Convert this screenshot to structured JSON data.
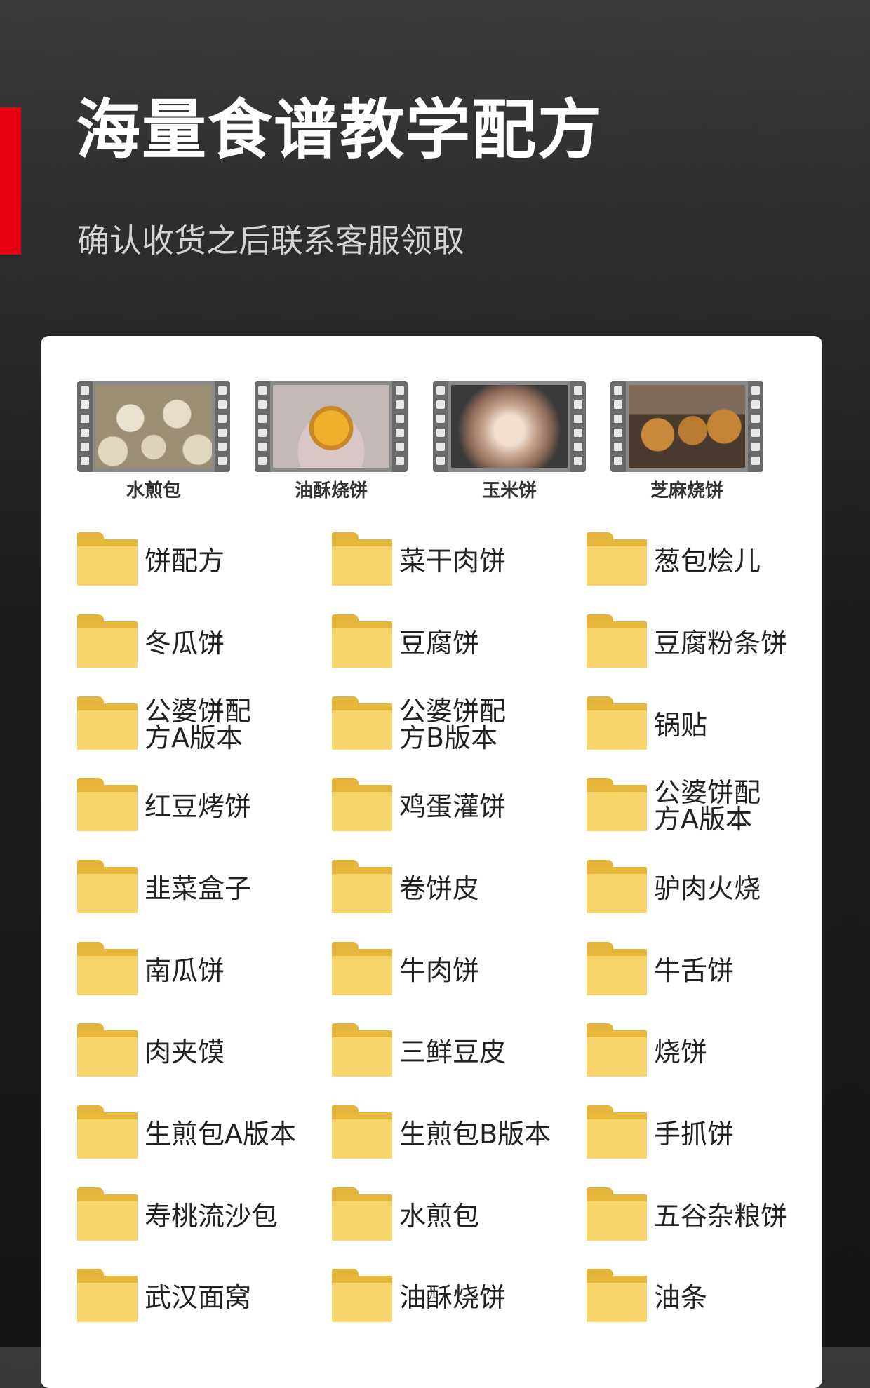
{
  "header": {
    "title": "海量食谱教学配方",
    "subtitle": "确认收货之后联系客服领取",
    "accent_color": "#e60012"
  },
  "videos": [
    {
      "label": "水煎包",
      "icon": "video-thumbnail-icon"
    },
    {
      "label": "油酥烧饼",
      "icon": "video-thumbnail-icon"
    },
    {
      "label": "玉米饼",
      "icon": "video-thumbnail-icon"
    },
    {
      "label": "芝麻烧饼",
      "icon": "video-thumbnail-icon"
    }
  ],
  "folder_icon": "folder-icon",
  "folder_color": "#f7d56b",
  "folders": [
    "饼配方",
    "菜干肉饼",
    "葱包烩儿",
    "冬瓜饼",
    "豆腐饼",
    "豆腐粉条饼",
    "公婆饼配方A版本",
    "公婆饼配方B版本",
    "锅贴",
    "红豆烤饼",
    "鸡蛋灌饼",
    "公婆饼配方A版本",
    "韭菜盒子",
    "卷饼皮",
    "驴肉火烧",
    "南瓜饼",
    "牛肉饼",
    "牛舌饼",
    "肉夹馍",
    "三鲜豆皮",
    "烧饼",
    "生煎包A版本",
    "生煎包B版本",
    "手抓饼",
    "寿桃流沙包",
    "水煎包",
    "五谷杂粮饼",
    "武汉面窝",
    "油酥烧饼",
    "油条"
  ]
}
